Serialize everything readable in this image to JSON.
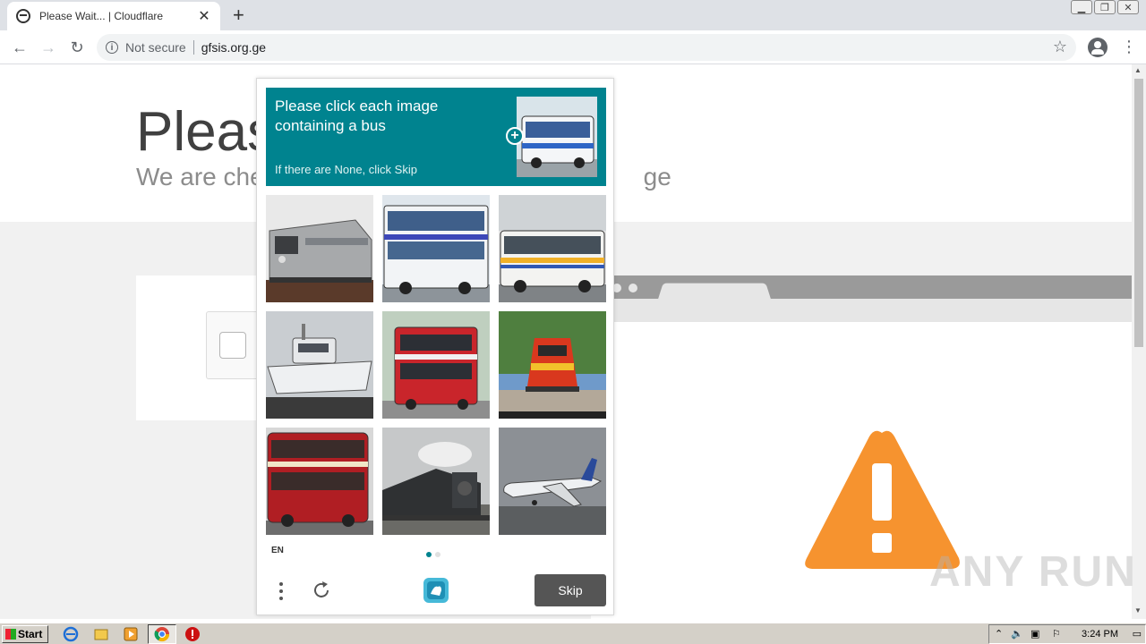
{
  "browser": {
    "tab_title": "Please Wait... | Cloudflare",
    "new_tab_symbol": "+",
    "security_label": "Not secure",
    "url": "gfsis.org.ge"
  },
  "page": {
    "title": "Please",
    "subtitle": "We are che",
    "subtitle_tail": "ge"
  },
  "captcha": {
    "prompt": "Please click each image containing a bus",
    "hint": "If there are None, click Skip",
    "language": "EN",
    "skip_label": "Skip",
    "tiles": [
      {
        "subject": "train"
      },
      {
        "subject": "bus"
      },
      {
        "subject": "bus"
      },
      {
        "subject": "boat"
      },
      {
        "subject": "bus"
      },
      {
        "subject": "train"
      },
      {
        "subject": "bus"
      },
      {
        "subject": "train"
      },
      {
        "subject": "airplane"
      }
    ],
    "page_dots": 2,
    "active_dot": 0,
    "accent_color": "#00838f"
  },
  "watermark": "ANY RUN",
  "taskbar": {
    "start_label": "Start",
    "clock": "3:24 PM"
  },
  "colors": {
    "warning": "#f6932f",
    "skip_button": "#555555"
  }
}
